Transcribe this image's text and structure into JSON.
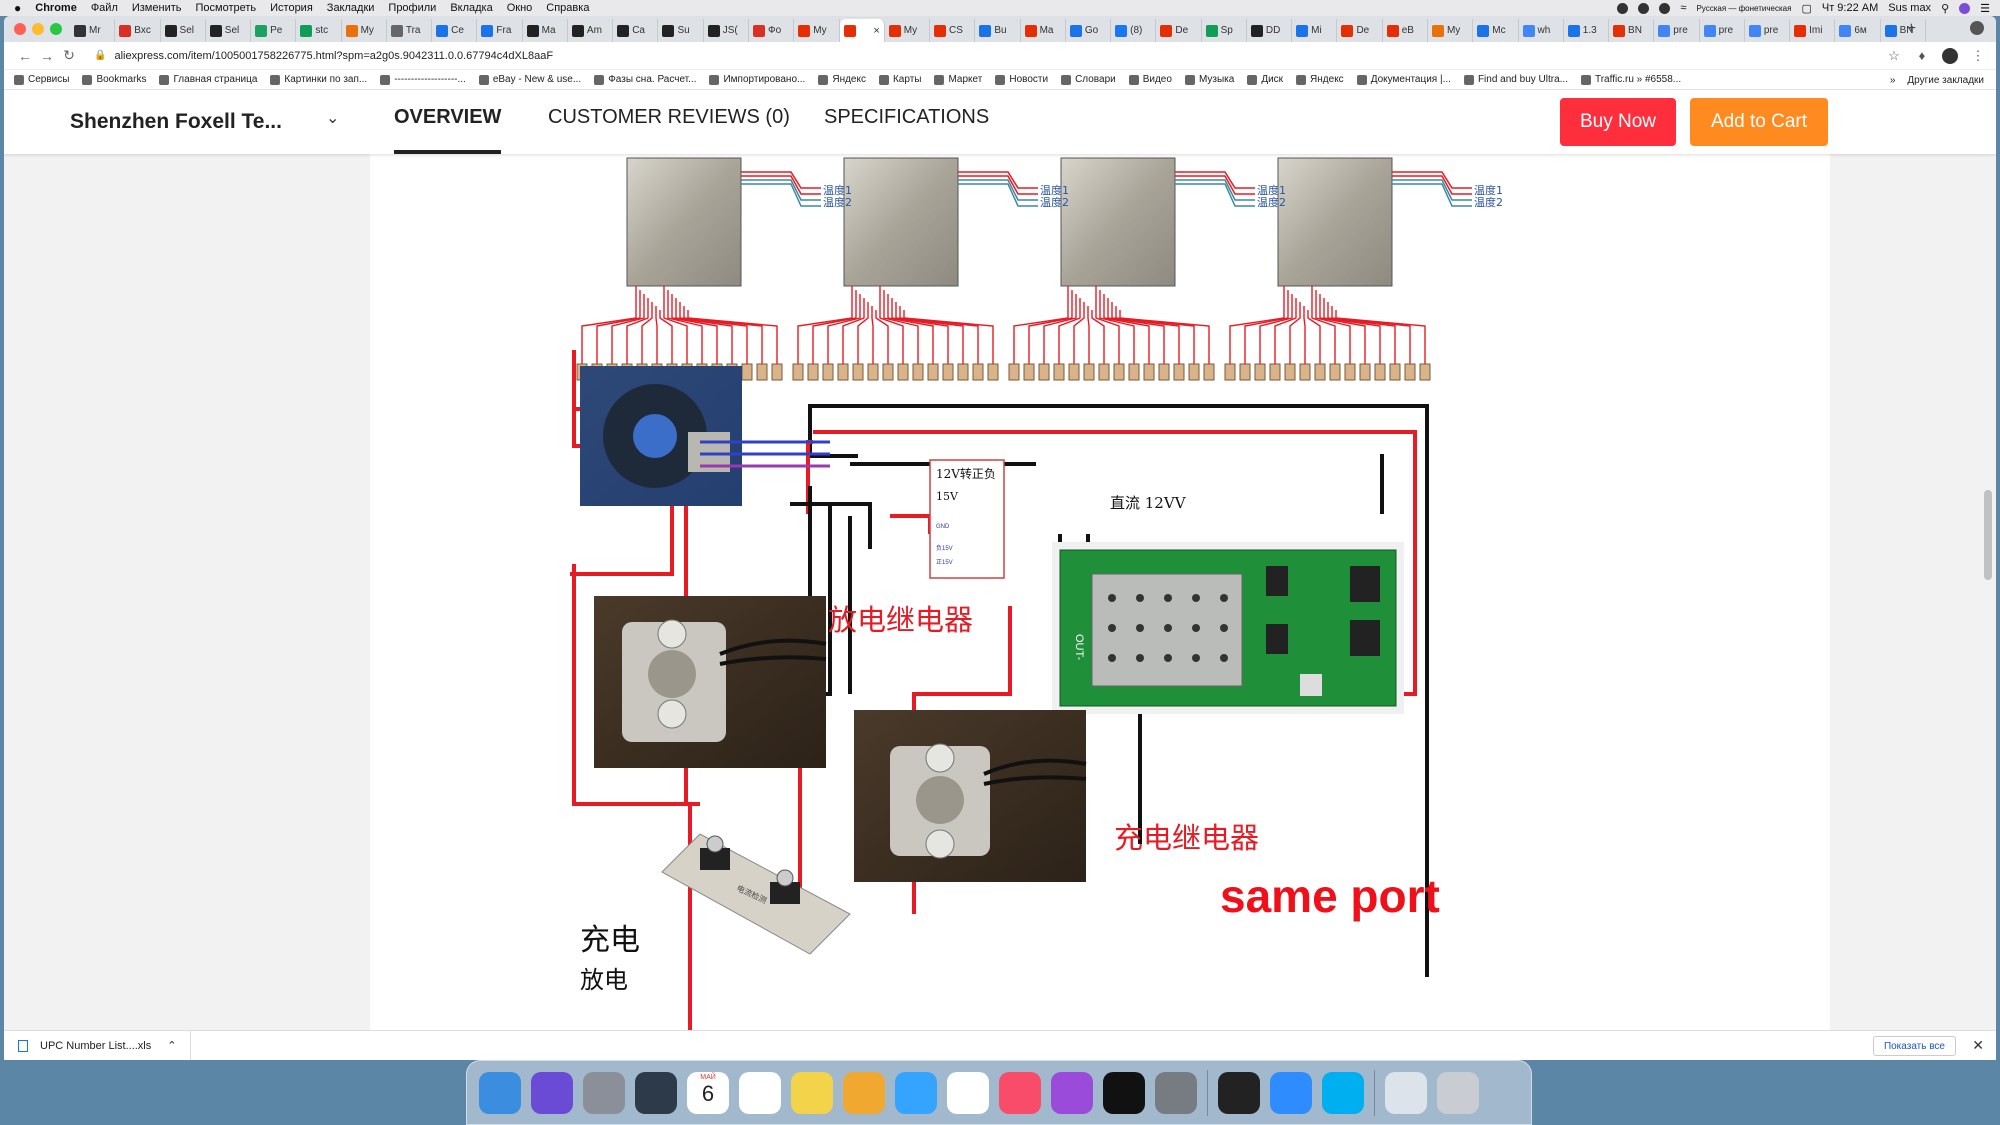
{
  "menubar": {
    "apple": "",
    "items": [
      "Chrome",
      "Файл",
      "Изменить",
      "Посмотреть",
      "История",
      "Закладки",
      "Профили",
      "Вкладка",
      "Окно",
      "Справка"
    ],
    "keyboard": "Русская — фонетическая",
    "time": "Чт 9:22 AM",
    "user": "Sus max"
  },
  "tabs": [
    {
      "label": "Mr",
      "color": "#333"
    },
    {
      "label": "Bxc",
      "color": "#d93025"
    },
    {
      "label": "Sel",
      "color": "#222"
    },
    {
      "label": "Sel",
      "color": "#222"
    },
    {
      "label": "Pe",
      "color": "#1aa260"
    },
    {
      "label": "stc",
      "color": "#0f9d58"
    },
    {
      "label": "My",
      "color": "#e8710a"
    },
    {
      "label": "Tra",
      "color": "#666"
    },
    {
      "label": "Ce",
      "color": "#1a73e8"
    },
    {
      "label": "Fra",
      "color": "#1a73e8"
    },
    {
      "label": "Ma",
      "color": "#222"
    },
    {
      "label": "Am",
      "color": "#222"
    },
    {
      "label": "Ca",
      "color": "#222"
    },
    {
      "label": "Su",
      "color": "#222"
    },
    {
      "label": "JS(",
      "color": "#222"
    },
    {
      "label": "Фо",
      "color": "#d93025"
    },
    {
      "label": "My",
      "color": "#e62e04"
    },
    {
      "label": "",
      "color": "#e62e04"
    },
    {
      "label": "My",
      "color": "#e62e04"
    },
    {
      "label": "CS",
      "color": "#e62e04"
    },
    {
      "label": "Bu",
      "color": "#1a73e8"
    },
    {
      "label": "Ma",
      "color": "#e62e04"
    },
    {
      "label": "Go",
      "color": "#1a73e8"
    },
    {
      "label": "(8)",
      "color": "#1877f2"
    },
    {
      "label": "De",
      "color": "#e62e04"
    },
    {
      "label": "Sp",
      "color": "#0f9d58"
    },
    {
      "label": "DD",
      "color": "#222"
    },
    {
      "label": "Mi",
      "color": "#1a73e8"
    },
    {
      "label": "De",
      "color": "#e62e04"
    },
    {
      "label": "eB",
      "color": "#e62e04"
    },
    {
      "label": "My",
      "color": "#e8710a"
    },
    {
      "label": "Mc",
      "color": "#1a73e8"
    },
    {
      "label": "wh",
      "color": "#4285f4"
    },
    {
      "label": "1.3",
      "color": "#1a73e8"
    },
    {
      "label": "BN",
      "color": "#e62e04"
    },
    {
      "label": "pre",
      "color": "#4285f4"
    },
    {
      "label": "pre",
      "color": "#4285f4"
    },
    {
      "label": "pre",
      "color": "#4285f4"
    },
    {
      "label": "Imi",
      "color": "#e62e04"
    },
    {
      "label": "6м",
      "color": "#4285f4"
    },
    {
      "label": "BN",
      "color": "#1a73e8"
    }
  ],
  "active_tab_index": 17,
  "toolbar": {
    "url": "aliexpress.com/item/1005001758226775.html?spm=a2g0s.9042311.0.0.67794c4dXL8aaF"
  },
  "bookmarks": {
    "items": [
      "Сервисы",
      "Bookmarks",
      "Главная страница",
      "Картинки по зап...",
      "-------------------...",
      "eBay - New & use...",
      "Фазы сна. Расчет...",
      "Импортировано...",
      "Яндекс",
      "Карты",
      "Маркет",
      "Новости",
      "Словари",
      "Видео",
      "Музыка",
      "Диск",
      "Яндекс",
      "Документация |...",
      "Find and buy Ultra...",
      "Traffic.ru » #6558..."
    ],
    "more": "»",
    "other": "Другие закладки"
  },
  "store": {
    "name": "Shenzhen Foxell Te...",
    "nav": [
      "OVERVIEW",
      "CUSTOMER REVIEWS (0)",
      "SPECIFICATIONS"
    ],
    "buy_now": "Buy Now",
    "add_to_cart": "Add to Cart"
  },
  "diagram": {
    "temp1": "温度1",
    "temp2": "温度2",
    "converter_title": "12V转正负",
    "converter_15v": "15V",
    "converter_gnd": "GND",
    "converter_neg": "负15V",
    "converter_pos": "正15V",
    "dc_label": "直流 12VV",
    "discharge_relay": "放电继电器",
    "charge_relay": "充电继电器",
    "charge": "充电",
    "discharge": "放电",
    "same_port": "same port",
    "board_label": "OUT-",
    "shunt_label": "电流检测"
  },
  "downloads": {
    "file": "UPC Number List....xls",
    "show_all": "Показать все"
  },
  "dock": {
    "calendar_month": "МАЙ",
    "calendar_day": "6",
    "apps": [
      "Finder",
      "Siri",
      "Launchpad",
      "Mission Control",
      "Calendar",
      "Reminders",
      "Notes",
      "Photos",
      "Messages",
      "Chrome",
      "Music",
      "Podcasts",
      "TV",
      "System Preferences",
      "Terminal",
      "Safari",
      "Skype",
      "Downloads",
      "Trash"
    ]
  }
}
